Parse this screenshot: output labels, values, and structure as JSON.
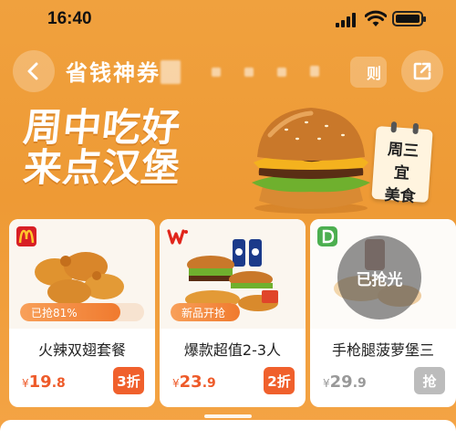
{
  "status": {
    "time": "16:40"
  },
  "nav": {
    "title": "省钱神券",
    "rule_label": "则"
  },
  "banner": {
    "headline_line1": "周中吃好",
    "headline_line2": "来点汉堡",
    "calendar_day": "周三",
    "calendar_text1": "宜",
    "calendar_text2": "美食"
  },
  "cards": [
    {
      "brand_icon": "mcdonalds-logo",
      "name": "火辣双翅套餐",
      "currency": "¥",
      "price_int": "19",
      "price_dec": ".8",
      "discount": "3折",
      "progress_label": "已抢81%",
      "progress_fraction": 0.81
    },
    {
      "brand_icon": "wallace-logo",
      "name": "爆款超值2-3人",
      "currency": "¥",
      "price_int": "23",
      "price_dec": ".9",
      "discount": "2折",
      "progress_label": "新品开抢"
    },
    {
      "brand_icon": "dicos-logo",
      "name": "手枪腿菠萝堡三",
      "currency": "¥",
      "price_int": "29",
      "price_dec": ".9",
      "discount": "抢",
      "sold_out_label": "已抢光"
    }
  ],
  "colors": {
    "background": "#ee9a35",
    "accent": "#f0602c",
    "price": "#ee5b2a",
    "disabled": "#bcbcbc"
  }
}
